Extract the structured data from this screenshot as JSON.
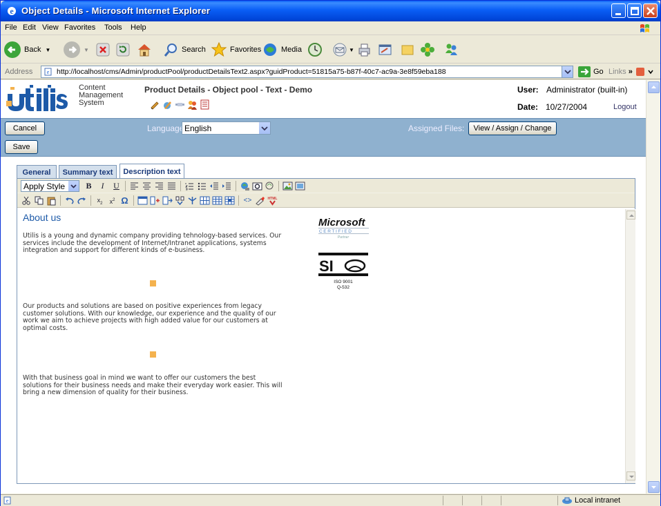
{
  "window": {
    "title": "Object Details - Microsoft Internet Explorer"
  },
  "menu": [
    "File",
    "Edit",
    "View",
    "Favorites",
    "Tools",
    "Help"
  ],
  "toolbar": {
    "back": "Back",
    "search": "Search",
    "favorites": "Favorites",
    "media": "Media"
  },
  "address": {
    "label": "Address",
    "url": "http://localhost/cms/Admin/productPool/productDetailsText2.aspx?guidProduct=51815a75-b87f-40c7-ac9a-3e8f59eba188",
    "go": "Go",
    "links": "Links"
  },
  "cms": {
    "caption_line1": "Content",
    "caption_line2": "Management",
    "caption_line3": "System",
    "page_title": "Product Details - Object pool - Text - Demo",
    "user_label": "User:",
    "user_value": "Administrator (built-in)",
    "date_label": "Date:",
    "date_value": "10/27/2004",
    "logout": "Logout"
  },
  "panel": {
    "cancel": "Cancel",
    "save": "Save",
    "language_label": "Language:",
    "language_value": "English",
    "assigned_label": "Assigned Files:",
    "assign_button": "View / Assign / Change"
  },
  "tabs": [
    {
      "label": "General",
      "active": false
    },
    {
      "label": "Summary text",
      "active": false
    },
    {
      "label": "Description text",
      "active": true
    }
  ],
  "editor": {
    "style_dropdown": "Apply Style",
    "heading": "About us",
    "para1": "Utilis is a young and dynamic company providing tehnology-based services. Our services include the development of Internet/Intranet applications, systems integration and support for different kinds of e-business.",
    "para2": "Our products and solutions are based on positive experiences from legacy customer solutions. With our knowledge, our experience and the quality of our work we aim to achieve projects with high added value for our customers at optimal costs.",
    "para3": "With that business goal in mind we want to offer our customers the best solutions for their business needs and make their everyday work easier. This will bring a new dimension of quality for their business."
  },
  "status": {
    "zone": "Local intranet"
  }
}
